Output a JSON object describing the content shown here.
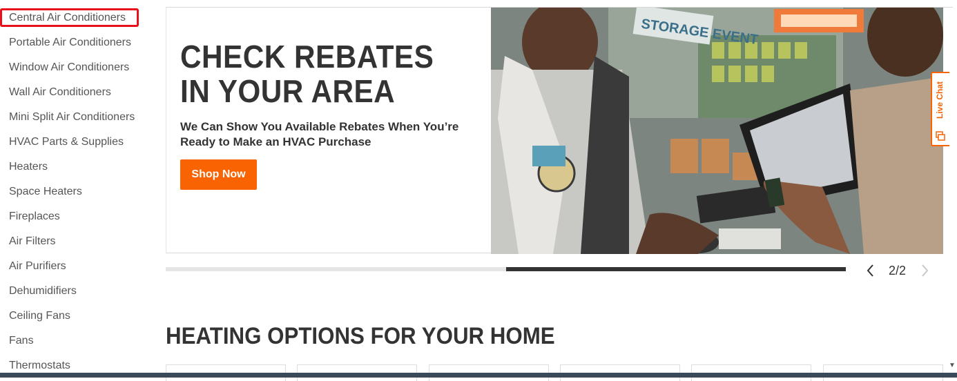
{
  "sidebar": {
    "items": [
      {
        "label": "Central Air Conditioners"
      },
      {
        "label": "Portable Air Conditioners"
      },
      {
        "label": "Window Air Conditioners"
      },
      {
        "label": "Wall Air Conditioners"
      },
      {
        "label": "Mini Split Air Conditioners"
      },
      {
        "label": "HVAC Parts & Supplies"
      },
      {
        "label": "Heaters"
      },
      {
        "label": "Space Heaters"
      },
      {
        "label": "Fireplaces"
      },
      {
        "label": "Air Filters"
      },
      {
        "label": "Air Purifiers"
      },
      {
        "label": "Dehumidifiers"
      },
      {
        "label": "Ceiling Fans"
      },
      {
        "label": "Fans"
      },
      {
        "label": "Thermostats"
      }
    ]
  },
  "banner": {
    "title": "CHECK REBATES IN YOUR AREA",
    "subtitle": "We Can Show You Available Rebates When You’re Ready to Make an HVAC Purchase",
    "button_label": "Shop Now",
    "photo_sign_text": "STORAGE EVENT"
  },
  "carousel": {
    "pager": "2/2",
    "prev_icon": "chevron-left-icon",
    "next_icon": "chevron-right-icon",
    "progress": 0.5
  },
  "section": {
    "title": "HEATING OPTIONS FOR YOUR HOME"
  },
  "live_chat": {
    "label": "Live Chat"
  },
  "colors": {
    "accent": "#f96302",
    "highlight": "#e8101a",
    "text": "#333333"
  }
}
